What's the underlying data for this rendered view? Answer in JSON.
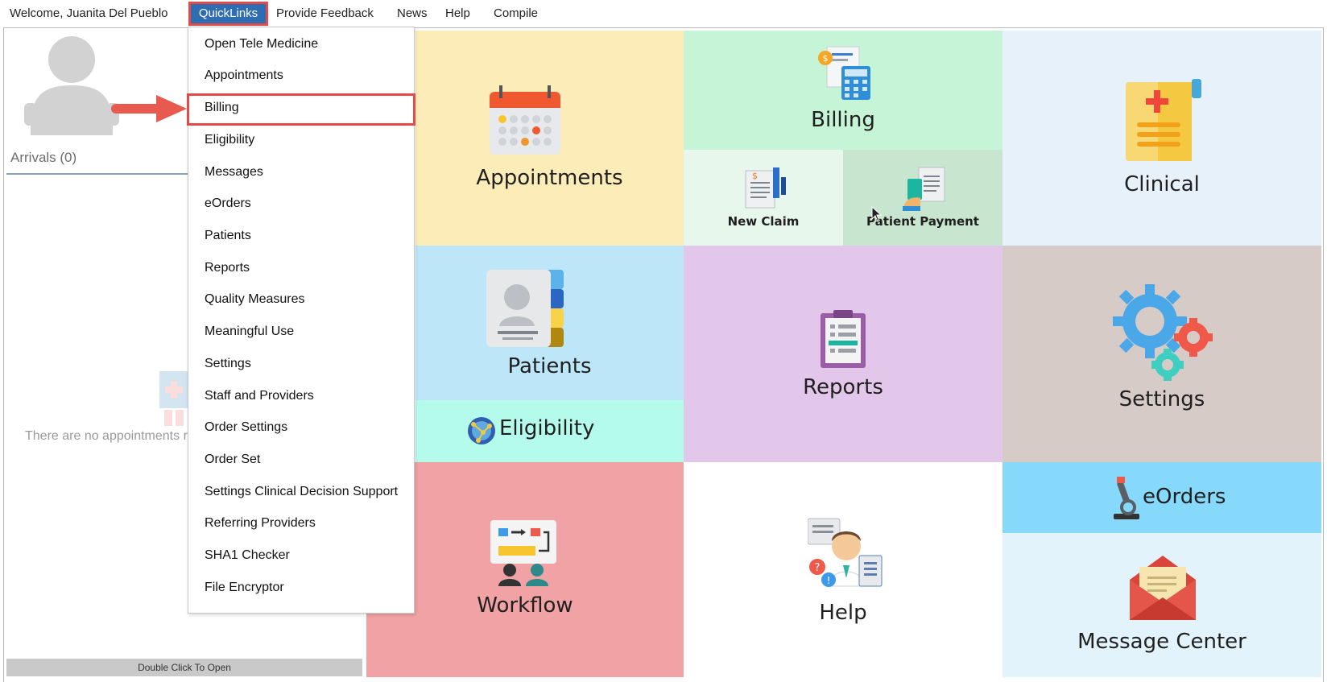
{
  "topbar": {
    "welcome": "Welcome, Juanita Del Pueblo",
    "quicklinks": "QuickLinks",
    "feedback": "Provide Feedback",
    "news": "News",
    "help": "Help",
    "compile": "Compile"
  },
  "left_panel": {
    "arrivals": "Arrivals (0)",
    "no_appointments": "There are no appointments r",
    "double_click": "Double Click To Open"
  },
  "quicklinks_menu": {
    "items": [
      "Open Tele Medicine",
      "Appointments",
      "Billing",
      "Eligibility",
      "Messages",
      "eOrders",
      "Patients",
      "Reports",
      "Quality Measures",
      "Meaningful Use",
      "Settings",
      "Staff and Providers",
      "Order Settings",
      "Order Set",
      "Settings Clinical Decision Support",
      "Referring Providers",
      "SHA1 Checker",
      "File Encryptor"
    ],
    "highlighted": "Billing"
  },
  "tiles": {
    "appointments": "Appointments",
    "billing": "Billing",
    "new_claim": "New Claim",
    "patient_payment": "Patient Payment",
    "clinical": "Clinical",
    "patients": "Patients",
    "eligibility": "Eligibility",
    "reports": "Reports",
    "settings": "Settings",
    "workflow": "Workflow",
    "help": "Help",
    "eorders": "eOrders",
    "message_center": "Message Center"
  },
  "colors": {
    "quicklinks_active": "#2f6db3",
    "highlight_red": "#e34b4b",
    "appointments_tile": "#fcecb8",
    "billing_tile": "#c5f5d6",
    "clinical_tile": "#e6f1fa",
    "patients_tile": "#bde6f9",
    "eligibility_tile": "#b5fbec",
    "reports_tile": "#e3c7ea",
    "settings_tile": "#d7cbc8",
    "workflow_tile": "#f0a2a4",
    "eorders_tile": "#86d9fb",
    "message_center_tile": "#e2f3fc"
  }
}
